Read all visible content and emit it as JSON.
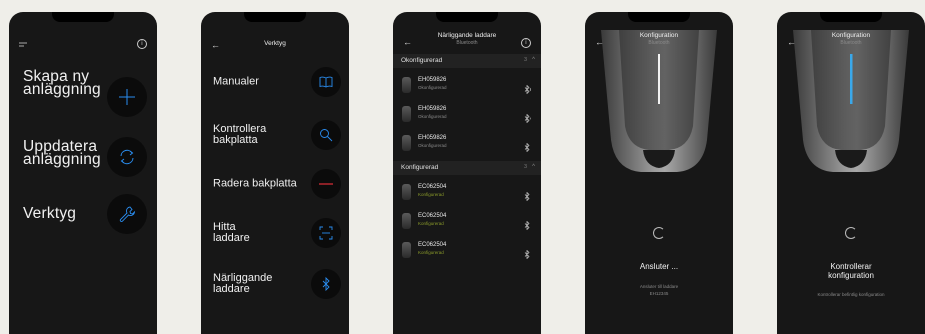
{
  "phone1": {
    "items": [
      {
        "label": "Skapa ny anläggning",
        "icon": "plus-icon"
      },
      {
        "label": "Uppdatera anläggning",
        "icon": "refresh-icon"
      },
      {
        "label": "Verktyg",
        "icon": "wrench-icon"
      }
    ],
    "info_glyph": "i",
    "accent": "#2a8df0"
  },
  "phone2": {
    "title": "Verktyg",
    "back_glyph": "←",
    "items": [
      {
        "label": "Manualer",
        "icon": "book-icon"
      },
      {
        "label": "Kontrollera bakplatta",
        "icon": "magnifier-icon"
      },
      {
        "label": "Radera bakplatta",
        "icon": "minus-icon"
      },
      {
        "label": "Hitta laddare",
        "icon": "scan-icon"
      },
      {
        "label": "Närliggande laddare",
        "icon": "bluetooth-icon"
      }
    ],
    "danger": "#e0303a"
  },
  "phone3": {
    "title": "Närliggande laddare",
    "subtitle": "Bluetooth",
    "back_glyph": "←",
    "info_glyph": "i",
    "sections": [
      {
        "name": "Okonfigurerad",
        "count": "3",
        "chevron": "^",
        "devices": [
          {
            "name": "EH059826",
            "status": "Okonfigurerad"
          },
          {
            "name": "EH059826",
            "status": "Okonfigurerad"
          },
          {
            "name": "EH059826",
            "status": "Okonfigurerad"
          }
        ]
      },
      {
        "name": "Konfigurerad",
        "count": "3",
        "chevron": "^",
        "devices": [
          {
            "name": "EC062504",
            "status": "Konfigurerad"
          },
          {
            "name": "EC062504",
            "status": "Konfigurerad"
          },
          {
            "name": "EC062504",
            "status": "Konfigurerad"
          }
        ]
      }
    ],
    "status_colors": {
      "unconfigured": "#8a8a8a",
      "configured": "#8a9a2a"
    }
  },
  "phone4": {
    "title": "Konfiguration",
    "subtitle": "Bluetooth",
    "back_glyph": "←",
    "status": "Ansluter ...",
    "detail_line1": "Ansluter till laddare",
    "detail_line2": "EH12345"
  },
  "phone5": {
    "title": "Konfiguration",
    "subtitle": "Bluetooth",
    "back_glyph": "←",
    "status": "Kontrollerar konfiguration",
    "detail_line1": "Kontrollerar befintlig konfiguration"
  }
}
